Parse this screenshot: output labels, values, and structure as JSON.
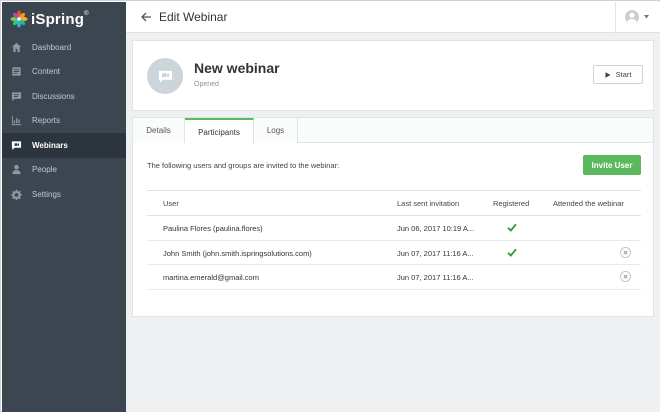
{
  "brand": {
    "name": "iSpring",
    "mark": "®"
  },
  "sidebar": {
    "items": [
      {
        "label": "Dashboard",
        "icon": "home-icon",
        "active": false
      },
      {
        "label": "Content",
        "icon": "content-icon",
        "active": false
      },
      {
        "label": "Discussions",
        "icon": "discussions-icon",
        "active": false
      },
      {
        "label": "Reports",
        "icon": "reports-icon",
        "active": false
      },
      {
        "label": "Webinars",
        "icon": "webinar-icon",
        "active": true
      },
      {
        "label": "People",
        "icon": "person-icon",
        "active": false
      },
      {
        "label": "Settings",
        "icon": "gear-icon",
        "active": false
      }
    ]
  },
  "header": {
    "title": "Edit Webinar"
  },
  "webinar": {
    "title": "New webinar",
    "status": "Opened",
    "start_label": "Start"
  },
  "tabs": [
    {
      "label": "Details",
      "active": false
    },
    {
      "label": "Participants",
      "active": true
    },
    {
      "label": "Logs",
      "active": false
    }
  ],
  "participants": {
    "intro": "The following users and groups are invited to the webinar:",
    "invite_label": "Invite User",
    "columns": [
      "User",
      "Last sent invitation",
      "Registered",
      "Attended the webinar"
    ],
    "rows": [
      {
        "user": "Paulina Flores (paulina.flores)",
        "last_sent": "Jun 06, 2017 10:19 A...",
        "registered": true,
        "removable": false
      },
      {
        "user": "John Smith (john.smith.ispringsolutions.com)",
        "last_sent": "Jun 07, 2017 11:16 A...",
        "registered": true,
        "removable": true
      },
      {
        "user": "martina.emerald@gmail.com",
        "last_sent": "Jun 07, 2017 11:16 A...",
        "registered": false,
        "removable": true
      }
    ]
  },
  "colors": {
    "sidebar_bg": "#3b4650",
    "sidebar_active": "#2c353d",
    "accent_green": "#5cb85c",
    "main_bg": "#eef0f2"
  }
}
